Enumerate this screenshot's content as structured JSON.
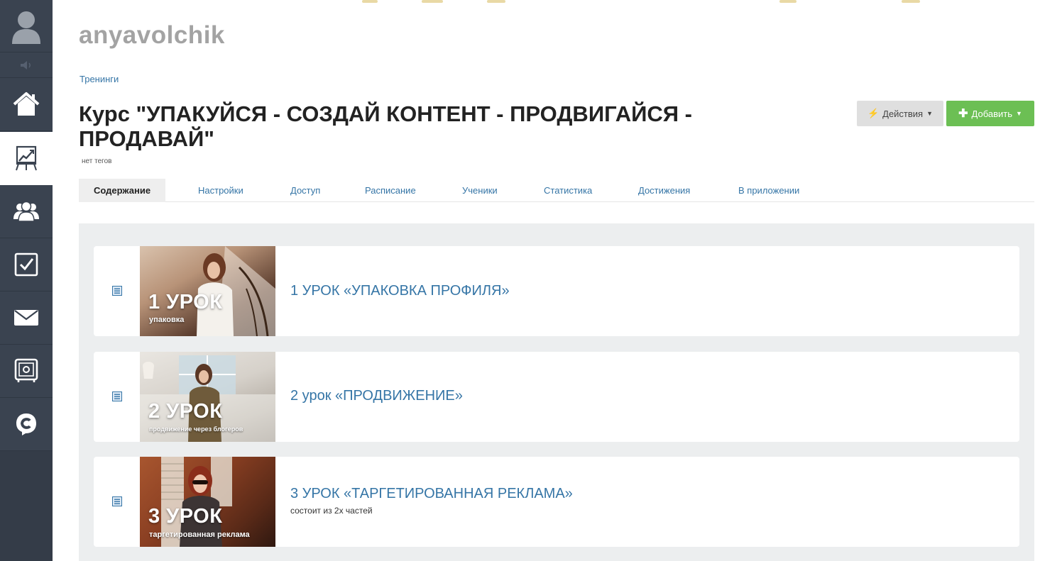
{
  "user": {
    "name": "anyavolchik"
  },
  "breadcrumb": {
    "label": "Тренинги"
  },
  "course": {
    "title": "Курс \"УПАКУЙСЯ - СОЗДАЙ КОНТЕНТ - ПРОДВИГАЙСЯ - ПРОДАВАЙ\"",
    "tags": "нет тегов"
  },
  "toolbar": {
    "actions_label": "Действия",
    "add_label": "Добавить"
  },
  "tabs": [
    {
      "label": "Содержание",
      "active": true
    },
    {
      "label": "Настройки"
    },
    {
      "label": "Доступ"
    },
    {
      "label": "Расписание"
    },
    {
      "label": "Ученики"
    },
    {
      "label": "Статистика"
    },
    {
      "label": "Достижения"
    },
    {
      "label": "В приложении"
    }
  ],
  "lessons": [
    {
      "title": "1 УРОК «УПАКОВКА ПРОФИЛЯ»",
      "description": "",
      "thumb_title": "1 УРОК",
      "thumb_subtitle": "упаковка"
    },
    {
      "title": "2 урок «ПРОДВИЖЕНИЕ»",
      "description": "",
      "thumb_title": "2 УРОК",
      "thumb_subtitle": "продвижение через блогеров"
    },
    {
      "title": "3 УРОК «ТАРГЕТИРОВАННАЯ РЕКЛАМА»",
      "description": "состоит из 2х частей",
      "thumb_title": "3 УРОК",
      "thumb_subtitle": "таргетированная реклама"
    }
  ],
  "sidebar": {
    "items": [
      {
        "icon": "home-icon"
      },
      {
        "icon": "trainings-chart-icon",
        "active": true
      },
      {
        "icon": "users-group-icon"
      },
      {
        "icon": "tasks-checkbox-icon"
      },
      {
        "icon": "mail-envelope-icon"
      },
      {
        "icon": "safe-icon"
      },
      {
        "icon": "chat-logo-icon"
      }
    ]
  },
  "colors": {
    "sidebar": "#3a4350",
    "link": "#3575a6",
    "add_button": "#6cbf54",
    "actions_button": "#dfdfdf",
    "panel": "#eceeef"
  }
}
